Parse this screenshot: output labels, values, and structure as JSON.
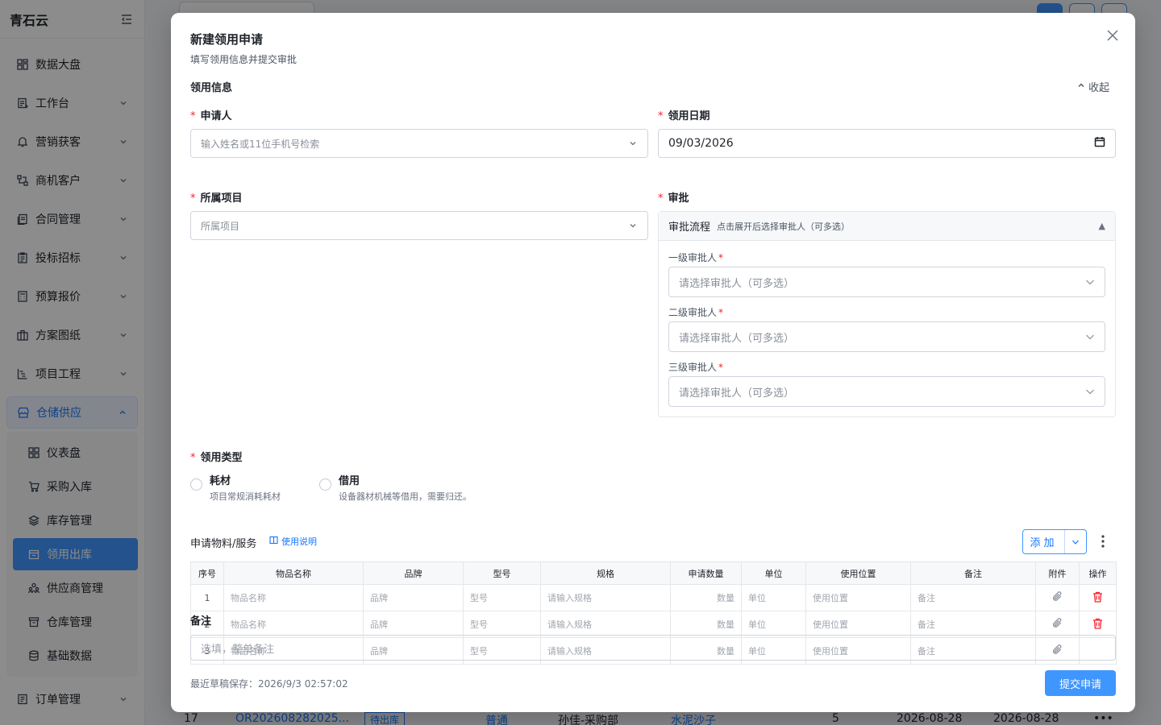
{
  "app": {
    "brand": "青石云"
  },
  "sidebar": {
    "items": [
      {
        "label": "数据大盘",
        "icon": "dashboard-icon",
        "chevron": false
      },
      {
        "label": "工作台",
        "icon": "clipboard-icon",
        "chevron": true
      },
      {
        "label": "营销获客",
        "icon": "bell-icon",
        "chevron": true
      },
      {
        "label": "商机客户",
        "icon": "network-icon",
        "chevron": true
      },
      {
        "label": "合同管理",
        "icon": "contract-icon",
        "chevron": true
      },
      {
        "label": "投标招标",
        "icon": "clipboard-list-icon",
        "chevron": true
      },
      {
        "label": "预算报价",
        "icon": "calculator-icon",
        "chevron": true
      },
      {
        "label": "方案图纸",
        "icon": "building-icon",
        "chevron": true
      },
      {
        "label": "项目工程",
        "icon": "gantt-icon",
        "chevron": true
      },
      {
        "label": "仓储供应",
        "icon": "store-icon",
        "chevron": true,
        "open": true
      }
    ],
    "sub_items": [
      {
        "label": "仪表盘",
        "icon": "dashboard-icon"
      },
      {
        "label": "采购入库",
        "icon": "cart-icon"
      },
      {
        "label": "库存管理",
        "icon": "layers-icon"
      },
      {
        "label": "领用出库",
        "icon": "outbound-icon",
        "active": true
      },
      {
        "label": "供应商管理",
        "icon": "users-icon"
      },
      {
        "label": "仓库管理",
        "icon": "archive-icon"
      },
      {
        "label": "基础数据",
        "icon": "database-icon"
      }
    ],
    "bottom_item": {
      "label": "订单管理",
      "icon": "order-icon"
    }
  },
  "background": {
    "row": {
      "no": "17",
      "order": "OR202608282025...",
      "status": "待出库",
      "level": "普通",
      "person": "孙佳-采购部",
      "item": "水泥沙子",
      "qty": "5",
      "date1": "2026-08-28",
      "date2": "2026-08-28",
      "more": "•••"
    }
  },
  "modal": {
    "title": "新建领用申请",
    "subtitle": "填写领用信息并提交审批",
    "section_title": "领用信息",
    "collapse_label": "收起",
    "applicant": {
      "label": "申请人",
      "placeholder": "输入姓名或11位手机号检索"
    },
    "date": {
      "label": "领用日期",
      "value": "09/03/2026"
    },
    "project": {
      "label": "所属项目",
      "placeholder": "所属项目"
    },
    "approval": {
      "label": "审批",
      "flow_title": "审批流程",
      "flow_hint": "点击展开后选择审批人（可多选）",
      "levels": [
        {
          "label": "一级审批人",
          "placeholder": "请选择审批人（可多选）"
        },
        {
          "label": "二级审批人",
          "placeholder": "请选择审批人（可多选）"
        },
        {
          "label": "三级审批人",
          "placeholder": "请选择审批人（可多选）"
        }
      ]
    },
    "type": {
      "label": "领用类型",
      "options": [
        {
          "name": "耗材",
          "desc": "项目常规消耗耗材"
        },
        {
          "name": "借用",
          "desc": "设备器材机械等借用，需要归还。"
        }
      ]
    },
    "materials": {
      "title": "申请物料/服务",
      "help": "使用说明",
      "add_label": "添加",
      "columns": [
        "序号",
        "物品名称",
        "品牌",
        "型号",
        "规格",
        "申请数量",
        "单位",
        "使用位置",
        "备注",
        "附件",
        "操作"
      ],
      "rows": [
        {
          "idx": "1",
          "name": "物品名称",
          "brand": "品牌",
          "model": "型号",
          "spec": "请输入规格",
          "qty": "数量",
          "unit": "单位",
          "location": "使用位置",
          "remark": "备注"
        },
        {
          "idx": "2",
          "name": "物品名称",
          "brand": "品牌",
          "model": "型号",
          "spec": "请输入规格",
          "qty": "数量",
          "unit": "单位",
          "location": "使用位置",
          "remark": "备注"
        },
        {
          "idx": "3",
          "name": "物品名称",
          "brand": "品牌",
          "model": "型号",
          "spec": "请输入规格",
          "qty": "数量",
          "unit": "单位",
          "location": "使用位置",
          "remark": "备注"
        }
      ]
    },
    "remark": {
      "label": "备注",
      "placeholder": "选填，整单备注"
    },
    "draft_saved": "最近草稿保存：2026/9/3 02:57:02",
    "submit_label": "提交申请"
  },
  "colors": {
    "primary": "#4096ff",
    "required": "#f5222d",
    "danger": "#f5222d"
  }
}
